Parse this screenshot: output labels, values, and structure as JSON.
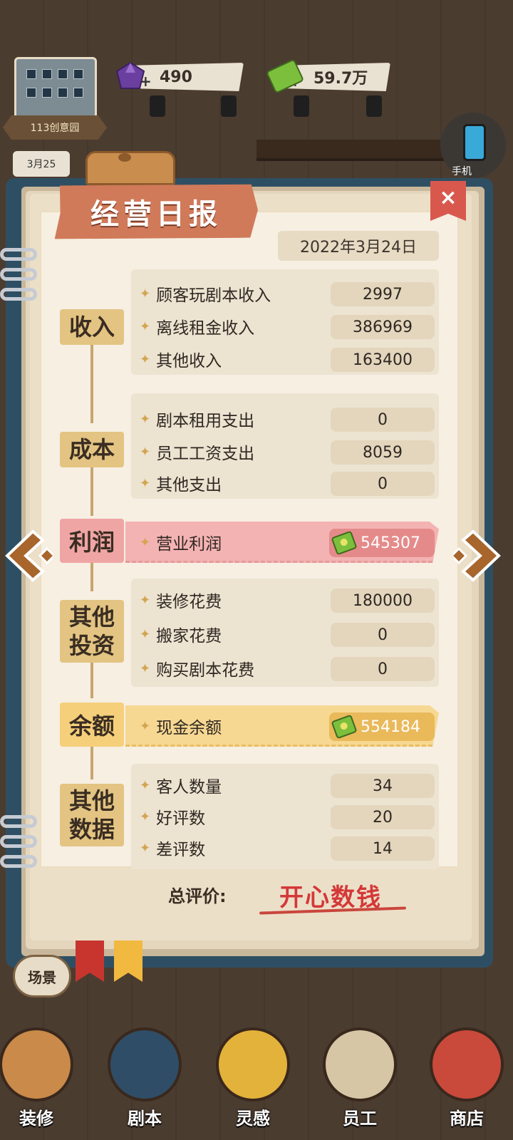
{
  "hud": {
    "place_name": "113创意园",
    "gems": "490",
    "cash": "59.7万",
    "phone_label": "手机",
    "calendar": "3月25"
  },
  "report": {
    "title": "经营日报",
    "close": "×",
    "date": "2022年3月24日",
    "income": {
      "label": "收入",
      "rows": [
        {
          "label": "顾客玩剧本收入",
          "value": "2997"
        },
        {
          "label": "离线租金收入",
          "value": "386969"
        },
        {
          "label": "其他收入",
          "value": "163400"
        }
      ]
    },
    "cost": {
      "label": "成本",
      "rows": [
        {
          "label": "剧本租用支出",
          "value": "0"
        },
        {
          "label": "员工工资支出",
          "value": "8059"
        },
        {
          "label": "其他支出",
          "value": "0"
        }
      ]
    },
    "profit": {
      "label": "利润",
      "row_label": "营业利润",
      "value": "545307"
    },
    "investment": {
      "label": "其他投资",
      "rows": [
        {
          "label": "装修花费",
          "value": "180000"
        },
        {
          "label": "搬家花费",
          "value": "0"
        },
        {
          "label": "购买剧本花费",
          "value": "0"
        }
      ]
    },
    "balance": {
      "label": "余额",
      "row_label": "现金余额",
      "value": "554184"
    },
    "other_data": {
      "label": "其他数据",
      "rows": [
        {
          "label": "客人数量",
          "value": "34"
        },
        {
          "label": "好评数",
          "value": "20"
        },
        {
          "label": "差评数",
          "value": "14"
        }
      ]
    },
    "total_label": "总评价:",
    "total_value": "开心数钱"
  },
  "bottom_nav": {
    "scene": "场景",
    "items": [
      "装修",
      "剧本",
      "灵感",
      "员工",
      "商店"
    ]
  },
  "colors": {
    "profit_bar": "#f4b3b3",
    "profit_label": "#f0a5a5",
    "profit_value": "#e58a8a",
    "balance_bar": "#f7d892",
    "balance_label": "#f5cf7a",
    "balance_value": "#e9b95a",
    "accent_gold": "#e3c482"
  }
}
